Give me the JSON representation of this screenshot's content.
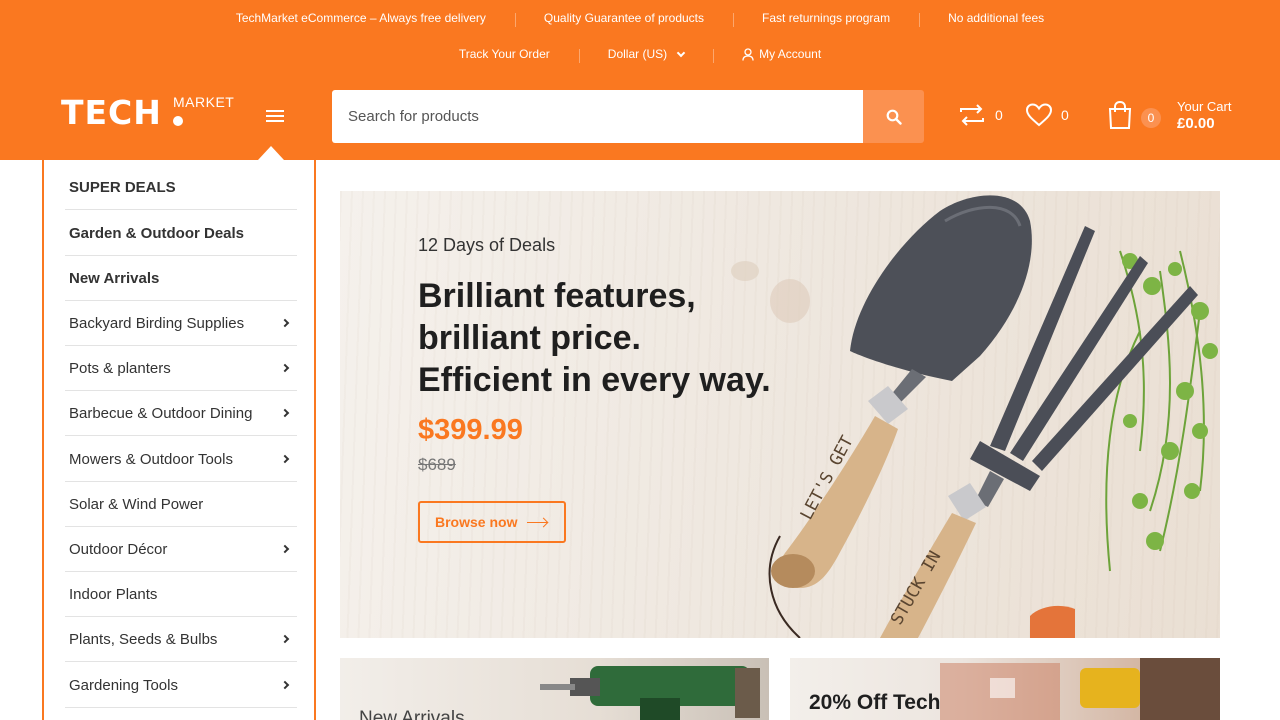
{
  "top_info": [
    "TechMarket eCommerce – Always free delivery",
    "Quality Guarantee of products",
    "Fast returnings program",
    "No additional fees"
  ],
  "util_links": {
    "track_order": "Track Your Order",
    "currency": "Dollar (US)",
    "account": "My Account"
  },
  "logo": {
    "main": "TECH",
    "sub": "MARKET"
  },
  "search": {
    "placeholder": "Search for products"
  },
  "header": {
    "compare_count": "0",
    "wishlist_count": "0",
    "cart_count": "0",
    "cart_label": "Your Cart",
    "cart_total": "£0.00"
  },
  "sidebar": {
    "items": [
      {
        "label": "SUPER DEALS",
        "bold": true,
        "arrow": false
      },
      {
        "label": "Garden & Outdoor Deals",
        "bold": true,
        "arrow": false
      },
      {
        "label": "New Arrivals",
        "bold": true,
        "arrow": false
      },
      {
        "label": "Backyard Birding Supplies",
        "bold": false,
        "arrow": true
      },
      {
        "label": "Pots & planters",
        "bold": false,
        "arrow": true
      },
      {
        "label": "Barbecue & Outdoor Dining",
        "bold": false,
        "arrow": true
      },
      {
        "label": "Mowers & Outdoor Tools",
        "bold": false,
        "arrow": true
      },
      {
        "label": "Solar & Wind Power",
        "bold": false,
        "arrow": false
      },
      {
        "label": "Outdoor Décor",
        "bold": false,
        "arrow": true
      },
      {
        "label": "Indoor Plants",
        "bold": false,
        "arrow": false
      },
      {
        "label": "Plants, Seeds & Bulbs",
        "bold": false,
        "arrow": true
      },
      {
        "label": "Gardening Tools",
        "bold": false,
        "arrow": true
      }
    ]
  },
  "banner": {
    "subtitle": "12 Days of Deals",
    "title_lines": [
      "Brilliant features,",
      "brilliant price.",
      "Efficient in every way."
    ],
    "price": "$399.99",
    "old_price": "$689",
    "cta": "Browse now",
    "tool_engravings": [
      "LET'S GET",
      "STUCK IN"
    ]
  },
  "promos": {
    "left_label": "New Arrivals",
    "right_title": "20% Off Tech"
  },
  "colors": {
    "brand": "#fa7820",
    "search_button": "#fb9150"
  }
}
